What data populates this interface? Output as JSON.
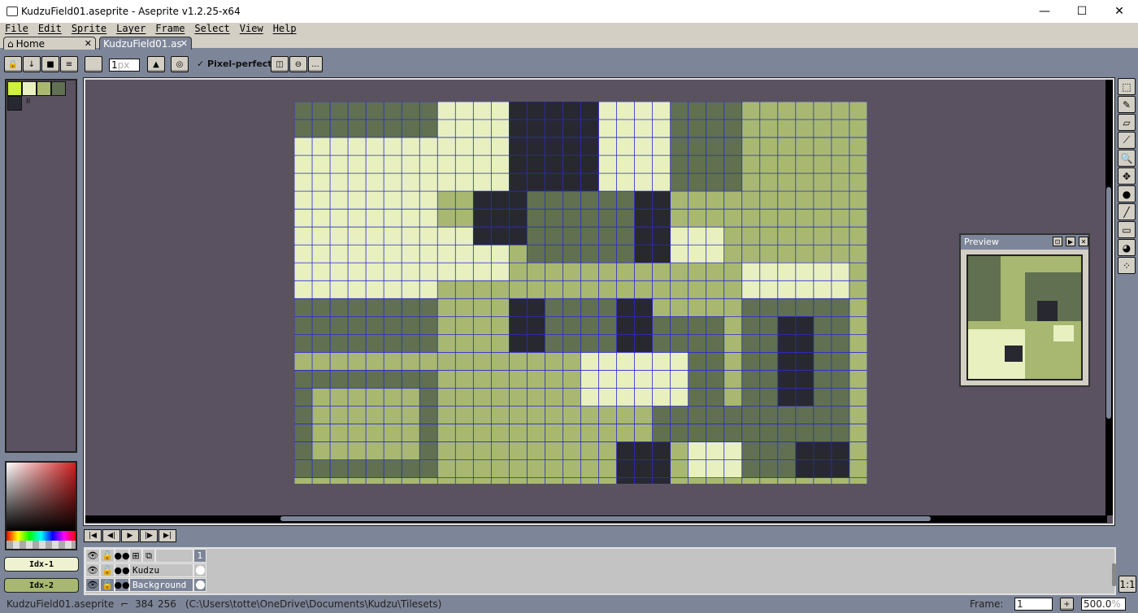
{
  "window": {
    "title": "KudzuField01.aseprite - Aseprite v1.2.25-x64",
    "minimize": "—",
    "maximize": "☐",
    "close": "✕"
  },
  "menu": [
    "File",
    "Edit",
    "Sprite",
    "Layer",
    "Frame",
    "Select",
    "View",
    "Help"
  ],
  "tabs": [
    {
      "label": "Home",
      "icon": "home-icon",
      "close": "✕"
    },
    {
      "label": "KudzuField01.as",
      "close": "✕",
      "active": true
    }
  ],
  "toolbar": {
    "brush_size": "1",
    "brush_unit": "px",
    "pixel_perfect": "Pixel-perfect",
    "more": "..."
  },
  "palette": {
    "colors": [
      "#d0f040",
      "#e8f0c0",
      "#a8b870",
      "#607050",
      "#282830"
    ],
    "selected_marker": "II"
  },
  "color_buttons": [
    {
      "label": "Idx-1",
      "color": "#eef2d0"
    },
    {
      "label": "Idx-2",
      "color": "#a8b870"
    }
  ],
  "tools": [
    "rectangular-marquee-icon",
    "pencil-icon",
    "eraser-icon",
    "eyedropper-icon",
    "zoom-icon",
    "move-icon",
    "paint-bucket-icon",
    "line-icon",
    "rectangle-icon",
    "blob-icon",
    "spray-icon"
  ],
  "preview": {
    "title": "Preview"
  },
  "timeline": {
    "frame_header": "1",
    "layers": [
      {
        "name": "Kudzu"
      },
      {
        "name": "Background"
      }
    ]
  },
  "status": {
    "filename": "KudzuField01.aseprite",
    "width": "384",
    "height": "256",
    "path": "(C:\\Users\\totte\\OneDrive\\Documents\\Kudzu\\Tilesets)",
    "frame_label": "Frame:",
    "frame_value": "1",
    "add": "+",
    "zoom": "500.0",
    "zoom_unit": "%",
    "one_to_one": "1:1"
  },
  "colors": {
    "canvas_bg": "#5a5260",
    "grid": "#2a2ad0",
    "sprite_light": "#e8f0c0",
    "sprite_mid": "#a8b870",
    "sprite_dark": "#607050",
    "sprite_darkest": "#282830"
  }
}
